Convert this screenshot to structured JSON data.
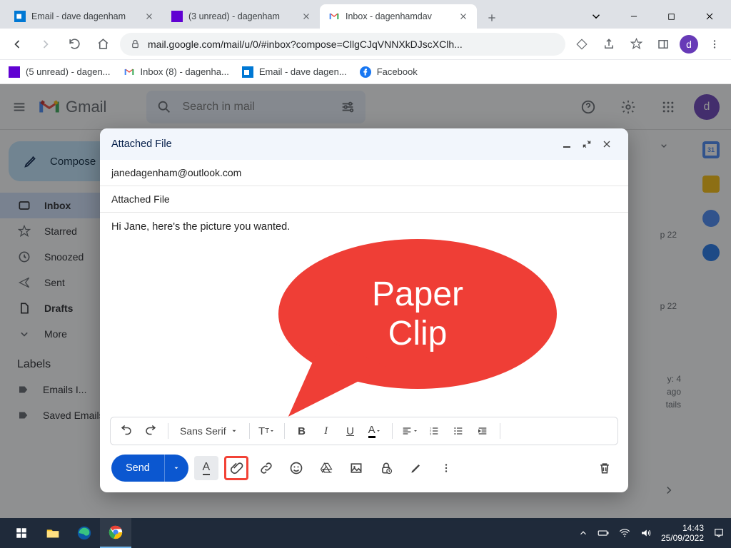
{
  "browser": {
    "tabs": [
      {
        "title": "Email - dave dagenham"
      },
      {
        "title": "(3 unread) - dagenham"
      },
      {
        "title": "Inbox - dagenhamdav"
      }
    ],
    "url": "mail.google.com/mail/u/0/#inbox?compose=CllgCJqVNNXkDJscXClh...",
    "bookmarks": [
      {
        "label": "(5 unread) - dagen..."
      },
      {
        "label": "Inbox (8) - dagenha..."
      },
      {
        "label": "Email - dave dagen..."
      },
      {
        "label": "Facebook"
      }
    ],
    "profile_initial": "d"
  },
  "gmail": {
    "brand": "Gmail",
    "search_placeholder": "Search in mail",
    "compose_label": "Compose",
    "folders": [
      {
        "label": "Inbox"
      },
      {
        "label": "Starred"
      },
      {
        "label": "Snoozed"
      },
      {
        "label": "Sent"
      },
      {
        "label": "Drafts"
      },
      {
        "label": "More"
      }
    ],
    "labels_header": "Labels",
    "labels": [
      {
        "label": "Emails I..."
      },
      {
        "label": "Saved Emails"
      }
    ],
    "profile_initial": "d",
    "peek": {
      "date1": "p 22",
      "date2": "p 22",
      "meta1": "y: 4",
      "meta2": "ago",
      "meta3": "tails"
    }
  },
  "compose": {
    "title": "Attached File",
    "to": "janedagenham@outlook.com",
    "subject": "Attached File",
    "body": "Hi Jane, here's the picture you wanted.",
    "font": "Sans Serif",
    "send_label": "Send"
  },
  "callout": {
    "text": "Paper Clip"
  },
  "taskbar": {
    "time": "14:43",
    "date": "25/09/2022"
  }
}
